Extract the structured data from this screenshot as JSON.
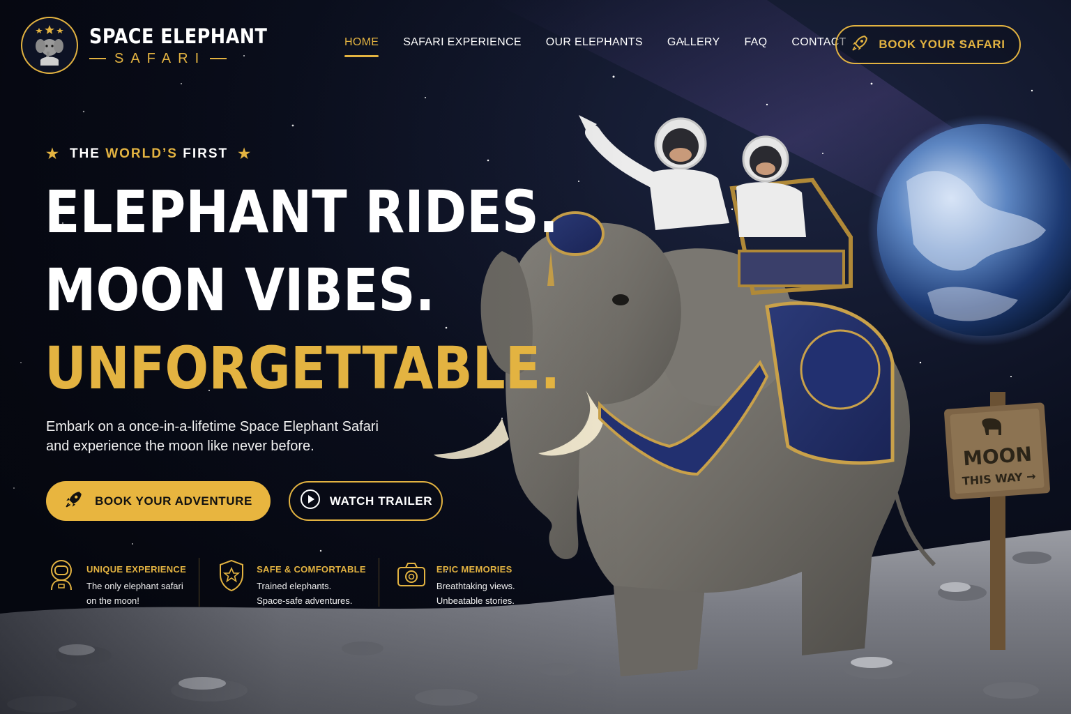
{
  "brand": {
    "title": "SPACE ELEPHANT",
    "subtitle": "SAFARI"
  },
  "nav": {
    "items": [
      {
        "label": "HOME",
        "active": true
      },
      {
        "label": "SAFARI EXPERIENCE",
        "active": false
      },
      {
        "label": "OUR ELEPHANTS",
        "active": false
      },
      {
        "label": "GALLERY",
        "active": false
      },
      {
        "label": "FAQ",
        "active": false
      },
      {
        "label": "CONTACT",
        "active": false
      }
    ],
    "cta_label": "BOOK YOUR SAFARI",
    "cta_icon": "rocket-icon"
  },
  "hero": {
    "eyebrow_pre": "THE",
    "eyebrow_highlight": "WORLD’S",
    "eyebrow_post": "FIRST",
    "headline_line1": "ELEPHANT RIDES.",
    "headline_line2": "MOON VIBES.",
    "headline_line3": "UNFORGETTABLE.",
    "description_line1": "Embark on a once-in-a-lifetime Space Elephant Safari",
    "description_line2": "and experience the moon like never before.",
    "primary_button": "BOOK YOUR ADVENTURE",
    "secondary_button": "WATCH TRAILER"
  },
  "features": [
    {
      "icon": "astronaut-icon",
      "title": "UNIQUE EXPERIENCE",
      "line1": "The only elephant safari",
      "line2": "on the moon!"
    },
    {
      "icon": "shield-star-icon",
      "title": "SAFE & COMFORTABLE",
      "line1": "Trained elephants.",
      "line2": "Space-safe adventures."
    },
    {
      "icon": "camera-icon",
      "title": "EPIC MEMORIES",
      "line1": "Breathtaking views.",
      "line2": "Unbeatable stories."
    }
  ],
  "sign": {
    "line1": "MOON",
    "line2": "THIS WAY"
  },
  "colors": {
    "accent": "#e3b341",
    "background": "#070a14",
    "text": "#ffffff"
  }
}
